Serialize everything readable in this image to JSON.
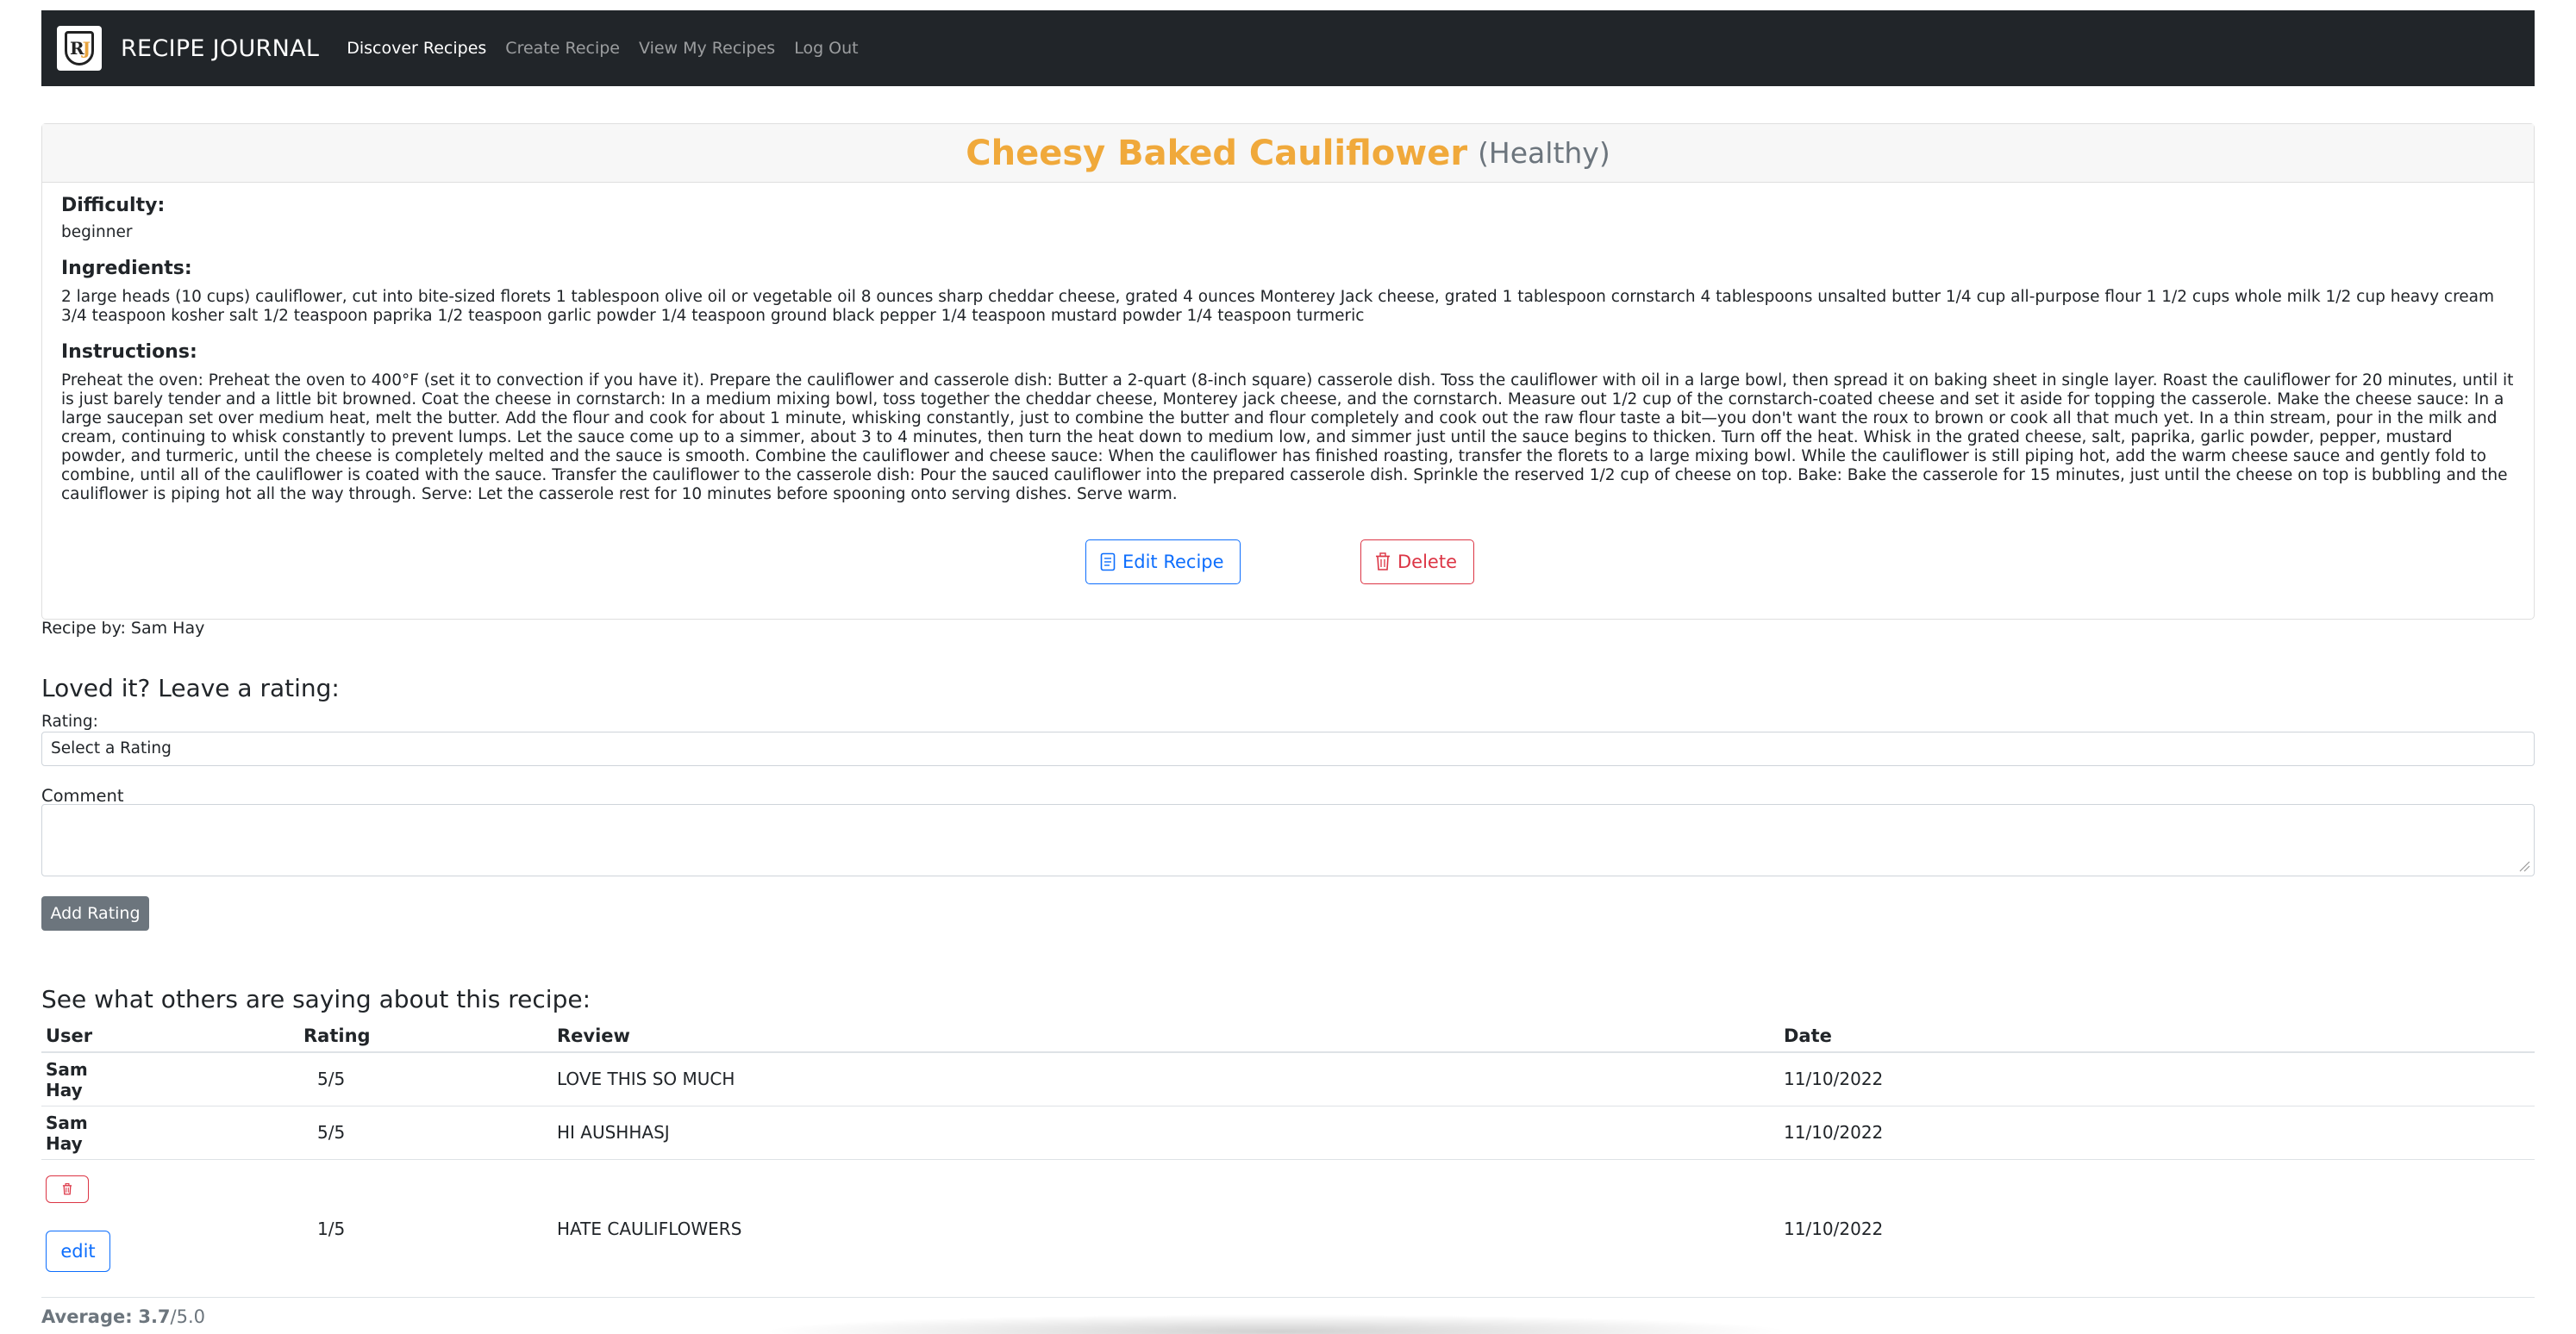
{
  "nav": {
    "brand": "RECIPE JOURNAL",
    "links": [
      "Discover Recipes",
      "Create Recipe",
      "View My Recipes",
      "Log Out"
    ],
    "active": "Discover Recipes",
    "logo_letters": [
      "R",
      "J"
    ]
  },
  "recipe": {
    "title": "Cheesy Baked Cauliflower",
    "category": "(Healthy)",
    "difficulty_label": "Difficulty:",
    "difficulty": "beginner",
    "ingredients_label": "Ingredients:",
    "ingredients": "2 large heads (10 cups) cauliflower, cut into bite-sized florets 1 tablespoon olive oil or vegetable oil 8 ounces sharp cheddar cheese, grated 4 ounces Monterey Jack cheese, grated 1 tablespoon cornstarch 4 tablespoons unsalted butter 1/4 cup all-purpose flour 1 1/2 cups whole milk 1/2 cup heavy cream 3/4 teaspoon kosher salt 1/2 teaspoon paprika 1/2 teaspoon garlic powder 1/4 teaspoon ground black pepper 1/4 teaspoon mustard powder 1/4 teaspoon turmeric",
    "instructions_label": "Instructions:",
    "instructions": "Preheat the oven: Preheat the oven to 400°F (set it to convection if you have it). Prepare the cauliflower and casserole dish: Butter a 2-quart (8-inch square) casserole dish. Toss the cauliflower with oil in a large bowl, then spread it on baking sheet in single layer. Roast the cauliflower for 20 minutes, until it is just barely tender and a little bit browned. Coat the cheese in cornstarch: In a medium mixing bowl, toss together the cheddar cheese, Monterey jack cheese, and the cornstarch. Measure out 1/2 cup of the cornstarch-coated cheese and set it aside for topping the casserole. Make the cheese sauce: In a large saucepan set over medium heat, melt the butter. Add the flour and cook for about 1 minute, whisking constantly, just to combine the butter and flour completely and cook out the raw flour taste a bit—you don't want the roux to brown or cook all that much yet. In a thin stream, pour in the milk and cream, continuing to whisk constantly to prevent lumps. Let the sauce come up to a simmer, about 3 to 4 minutes, then turn the heat down to medium low, and simmer just until the sauce begins to thicken. Turn off the heat. Whisk in the grated cheese, salt, paprika, garlic powder, pepper, mustard powder, and turmeric, until the cheese is completely melted and the sauce is smooth. Combine the cauliflower and cheese sauce: When the cauliflower has finished roasting, transfer the florets to a large mixing bowl. While the cauliflower is still piping hot, add the warm cheese sauce and gently fold to combine, until all of the cauliflower is coated with the sauce. Transfer the cauliflower to the casserole dish: Pour the sauced cauliflower into the prepared casserole dish. Sprinkle the reserved 1/2 cup of cheese on top. Bake: Bake the casserole for 15 minutes, just until the cheese on top is bubbling and the cauliflower is piping hot all the way through. Serve: Let the casserole rest for 10 minutes before spooning onto serving dishes. Serve warm.",
    "edit_label": "Edit Recipe",
    "delete_label": "Delete",
    "author": "Recipe by: Sam Hay"
  },
  "rating_form": {
    "heading": "Loved it? Leave a rating:",
    "rating_label": "Rating:",
    "rating_value": "Select a Rating",
    "comment_label": "Comment",
    "submit_label": "Add Rating"
  },
  "reviews": {
    "heading": "See what others are saying about this recipe:",
    "columns": [
      "User",
      "Rating",
      "Review",
      "Date"
    ],
    "rows": [
      {
        "user_line1": "Sam",
        "user_line2": "Hay",
        "rating": "5/5",
        "review": "LOVE THIS SO MUCH",
        "date": "11/10/2022"
      },
      {
        "user_line1": "Sam",
        "user_line2": "Hay",
        "rating": "5/5",
        "review": "HI AUSHHASJ",
        "date": "11/10/2022"
      },
      {
        "edit_label": "edit",
        "rating": "1/5",
        "review": "HATE CAULIFLOWERS",
        "date": "11/10/2022"
      }
    ]
  },
  "average": {
    "label": "Average:",
    "value": "3.7",
    "max": "/5.0"
  },
  "colors": {
    "navbar": "#212529",
    "title": "#f0a93b",
    "primary": "#0d6efd",
    "danger": "#dc3545",
    "secondary": "#6c757d"
  },
  "icons": [
    "document-icon",
    "trash-icon"
  ]
}
